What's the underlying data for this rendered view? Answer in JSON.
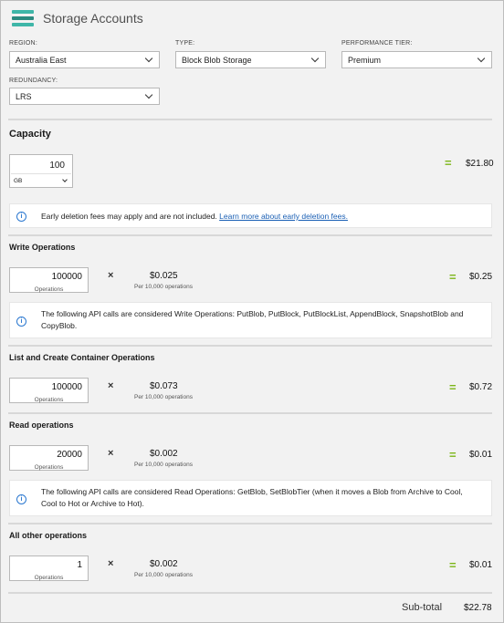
{
  "app": {
    "title": "Storage Accounts"
  },
  "filters": {
    "region": {
      "label": "REGION:",
      "value": "Australia East"
    },
    "type": {
      "label": "TYPE:",
      "value": "Block Blob Storage"
    },
    "performance_tier": {
      "label": "PERFORMANCE TIER:",
      "value": "Premium"
    },
    "redundancy": {
      "label": "REDUNDANCY:",
      "value": "LRS"
    }
  },
  "capacity": {
    "title": "Capacity",
    "value": "100",
    "unit": "GB",
    "equals": "=",
    "total": "$21.80",
    "info": {
      "text": "Early deletion fees may apply and are not included. ",
      "link": "Learn more about early deletion fees."
    }
  },
  "write_ops": {
    "title": "Write Operations",
    "value": "100000",
    "unit": "Operations",
    "times": "×",
    "price": "$0.025",
    "per": "Per 10,000 operations",
    "equals": "=",
    "total": "$0.25",
    "info": "The following API calls are considered Write Operations: PutBlob, PutBlock, PutBlockList, AppendBlock, SnapshotBlob and CopyBlob."
  },
  "list_ops": {
    "title": "List and Create Container Operations",
    "value": "100000",
    "unit": "Operations",
    "times": "×",
    "price": "$0.073",
    "per": "Per 10,000 operations",
    "equals": "=",
    "total": "$0.72"
  },
  "read_ops": {
    "title": "Read operations",
    "value": "20000",
    "unit": "Operations",
    "times": "×",
    "price": "$0.002",
    "per": "Per 10,000 operations",
    "equals": "=",
    "total": "$0.01",
    "info": "The following API calls are considered Read Operations: GetBlob, SetBlobTier (when it moves a Blob from Archive to Cool, Cool to Hot or Archive to Hot)."
  },
  "other_ops": {
    "title": "All other operations",
    "value": "1",
    "unit": "Operations",
    "times": "×",
    "price": "$0.002",
    "per": "Per 10,000 operations",
    "equals": "=",
    "total": "$0.01"
  },
  "subtotal": {
    "label": "Sub-total",
    "value": "$22.78"
  },
  "colors": {
    "accent_green": "#7cb518",
    "info_blue": "#2b78d0",
    "logo_teal": "#3fb6a8"
  },
  "icons": {
    "logo": "storage-accounts-logo",
    "info": "info-icon",
    "dropdown": "chevron-down-icon"
  }
}
